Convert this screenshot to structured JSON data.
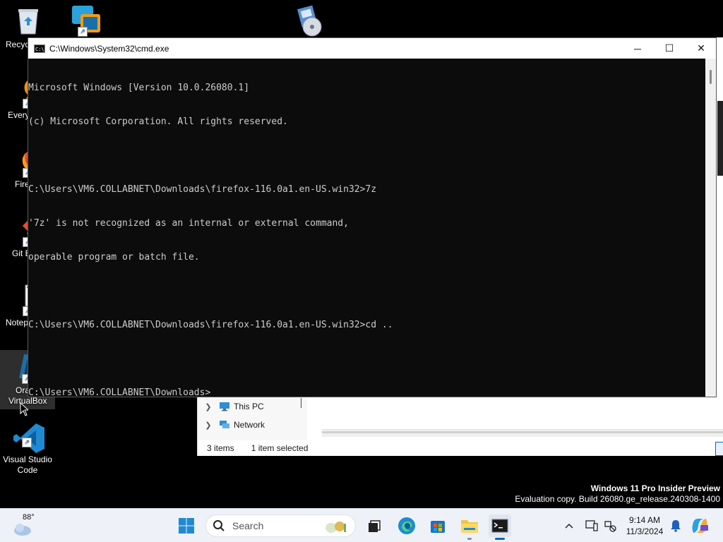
{
  "desktop": {
    "icons": [
      {
        "label": "Recyc",
        "icon": "recycle-bin-icon"
      },
      {
        "label": "",
        "icon": "virtualbox-app-icon"
      },
      {
        "label": "",
        "icon": "installer-disc-icon"
      },
      {
        "label": "Every",
        "icon": "everything-search-icon"
      },
      {
        "label": "Fire",
        "icon": "firefox-icon"
      },
      {
        "label": "Git B",
        "icon": "git-bash-icon"
      },
      {
        "label": "Notep",
        "icon": "notepad-plus-plus-icon"
      },
      {
        "label_line1": "Ora",
        "label_line2": "VirtualBox",
        "icon": "oracle-virtualbox-icon"
      },
      {
        "label_line1": "Visual Studio",
        "label_line2": "Code",
        "icon": "vscode-icon"
      }
    ]
  },
  "cmd_window": {
    "title": "C:\\Windows\\System32\\cmd.exe",
    "minimize_label": "─",
    "maximize_label": "☐",
    "close_label": "✕",
    "lines": [
      "Microsoft Windows [Version 10.0.26080.1]",
      "(c) Microsoft Corporation. All rights reserved.",
      "",
      "C:\\Users\\VM6.COLLABNET\\Downloads\\firefox-116.0a1.en-US.win32>7z",
      "'7z' is not recognized as an internal or external command,",
      "operable program or batch file.",
      "",
      "C:\\Users\\VM6.COLLABNET\\Downloads\\firefox-116.0a1.en-US.win32>cd ..",
      "",
      "C:\\Users\\VM6.COLLABNET\\Downloads>"
    ]
  },
  "explorer": {
    "nav": [
      {
        "label": "This PC",
        "icon": "this-pc-icon"
      },
      {
        "label": "Network",
        "icon": "network-icon"
      }
    ],
    "status_items": "3 items",
    "status_selected": "1 item selected"
  },
  "watermark": {
    "line1": "Windows 11 Pro Insider Preview",
    "line2": "Evaluation copy. Build 26080.ge_release.240308-1400"
  },
  "taskbar": {
    "weather_temp": "88°",
    "search_placeholder": "Search",
    "time": "9:14 AM",
    "date": "11/3/2024"
  },
  "colors": {
    "console_bg": "#0c0c0c",
    "console_text": "#cccccc",
    "accent": "#0067c0",
    "taskbar_bg": "#eef2f8"
  }
}
